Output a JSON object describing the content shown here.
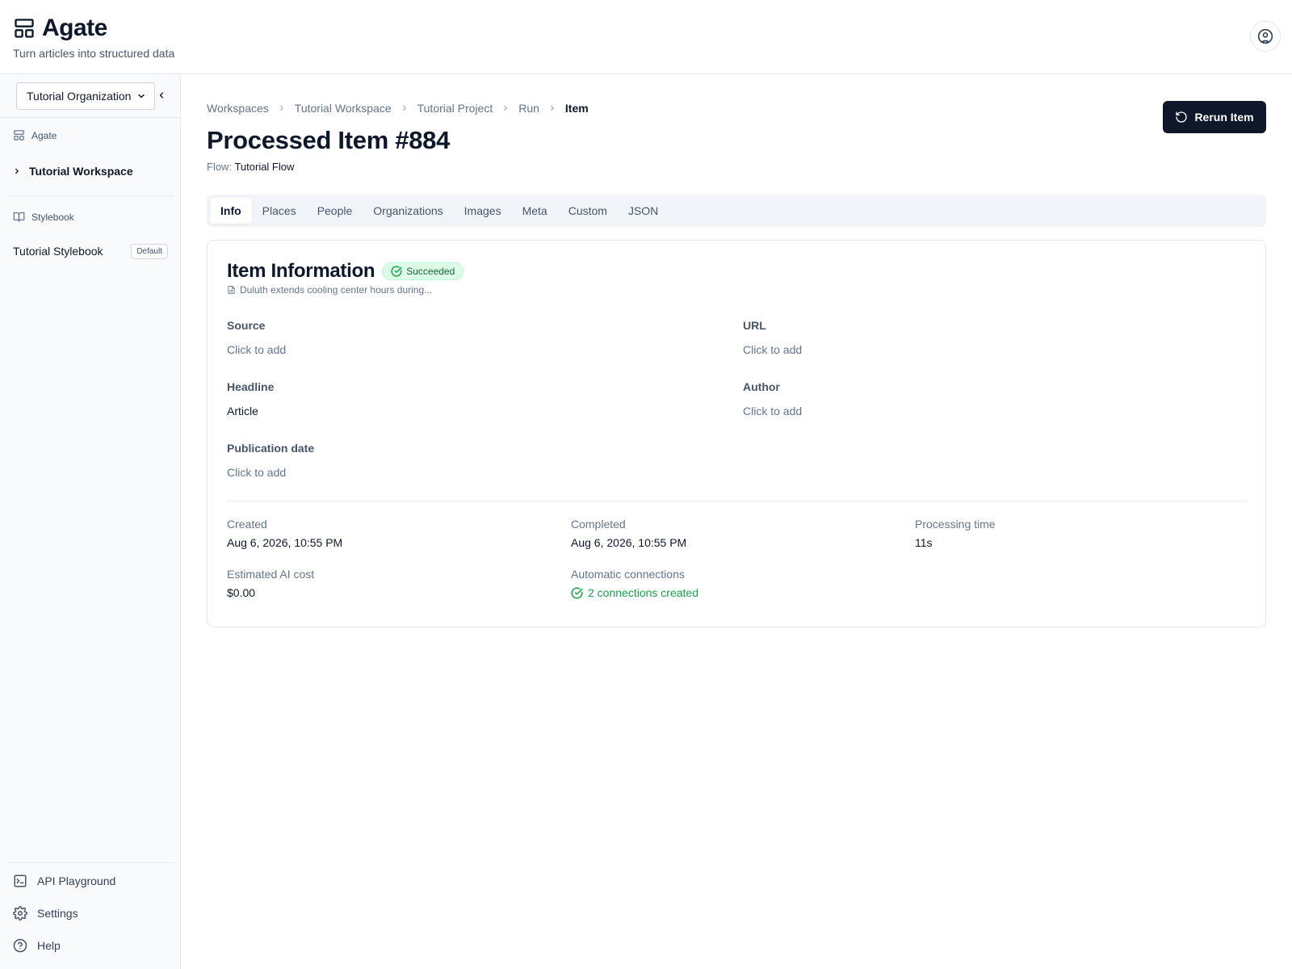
{
  "app": {
    "name": "Agate",
    "tagline": "Turn articles into structured data"
  },
  "sidebar": {
    "organization": "Tutorial Organization",
    "sections": {
      "agate_label": "Agate",
      "workspace_item": "Tutorial Workspace",
      "stylebook_label": "Stylebook",
      "stylebook_item": "Tutorial Stylebook",
      "stylebook_badge": "Default"
    },
    "bottom": {
      "api": "API Playground",
      "settings": "Settings",
      "help": "Help"
    }
  },
  "breadcrumb": [
    "Workspaces",
    "Tutorial Workspace",
    "Tutorial Project",
    "Run",
    "Item"
  ],
  "page": {
    "title": "Processed Item #884",
    "flow_label": "Flow:",
    "flow_name": "Tutorial Flow",
    "rerun_label": "Rerun Item"
  },
  "tabs": [
    "Info",
    "Places",
    "People",
    "Organizations",
    "Images",
    "Meta",
    "Custom",
    "JSON"
  ],
  "card": {
    "title": "Item Information",
    "status": "Succeeded",
    "article_ref": "Duluth extends cooling center hours during...",
    "fields": {
      "source": {
        "label": "Source",
        "value": "Click to add"
      },
      "url": {
        "label": "URL",
        "value": "Click to add"
      },
      "headline": {
        "label": "Headline",
        "value": "Article"
      },
      "author": {
        "label": "Author",
        "value": "Click to add"
      },
      "publication_date": {
        "label": "Publication date",
        "value": "Click to add"
      }
    },
    "meta": {
      "created": {
        "label": "Created",
        "value": "Aug 6, 2026, 10:55 PM"
      },
      "completed": {
        "label": "Completed",
        "value": "Aug 6, 2026, 10:55 PM"
      },
      "processing_time": {
        "label": "Processing time",
        "value": "11s"
      },
      "estimated_cost": {
        "label": "Estimated AI cost",
        "value": "$0.00"
      },
      "connections": {
        "label": "Automatic connections",
        "value": "2 connections created"
      }
    }
  },
  "colors": {
    "primary": "#0f172a",
    "success": "#16a34a",
    "success_bg": "#dcfce7",
    "muted": "#64748b"
  }
}
